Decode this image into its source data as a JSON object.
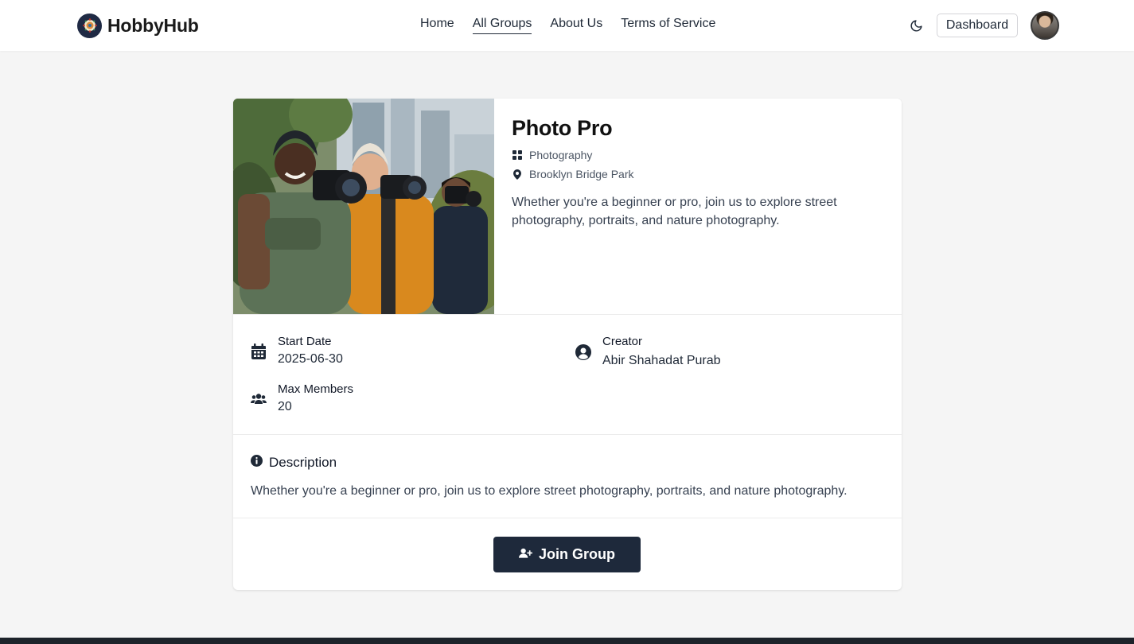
{
  "nav": {
    "brand": "HobbyHub",
    "links": [
      {
        "label": "Home",
        "active": false
      },
      {
        "label": "All Groups",
        "active": true
      },
      {
        "label": "About Us",
        "active": false
      },
      {
        "label": "Terms of Service",
        "active": false
      }
    ],
    "theme_icon": "moon-icon",
    "dashboard_label": "Dashboard"
  },
  "group": {
    "title": "Photo Pro",
    "category": "Photography",
    "location": "Brooklyn Bridge Park",
    "summary": "Whether you're a beginner or pro, join us to explore street photography, portraits, and nature photography.",
    "start_date_label": "Start Date",
    "start_date": "2025-06-30",
    "creator_label": "Creator",
    "creator": "Abir Shahadat Purab",
    "max_members_label": "Max Members",
    "max_members": "20",
    "description_heading": "Description",
    "description": "Whether you're a beginner or pro, join us to explore street photography, portraits, and nature photography.",
    "join_label": "Join Group"
  },
  "colors": {
    "primary": "#1e293b",
    "page_bg": "#f5f5f5",
    "card_bg": "#ffffff",
    "footer": "#1d232a"
  }
}
